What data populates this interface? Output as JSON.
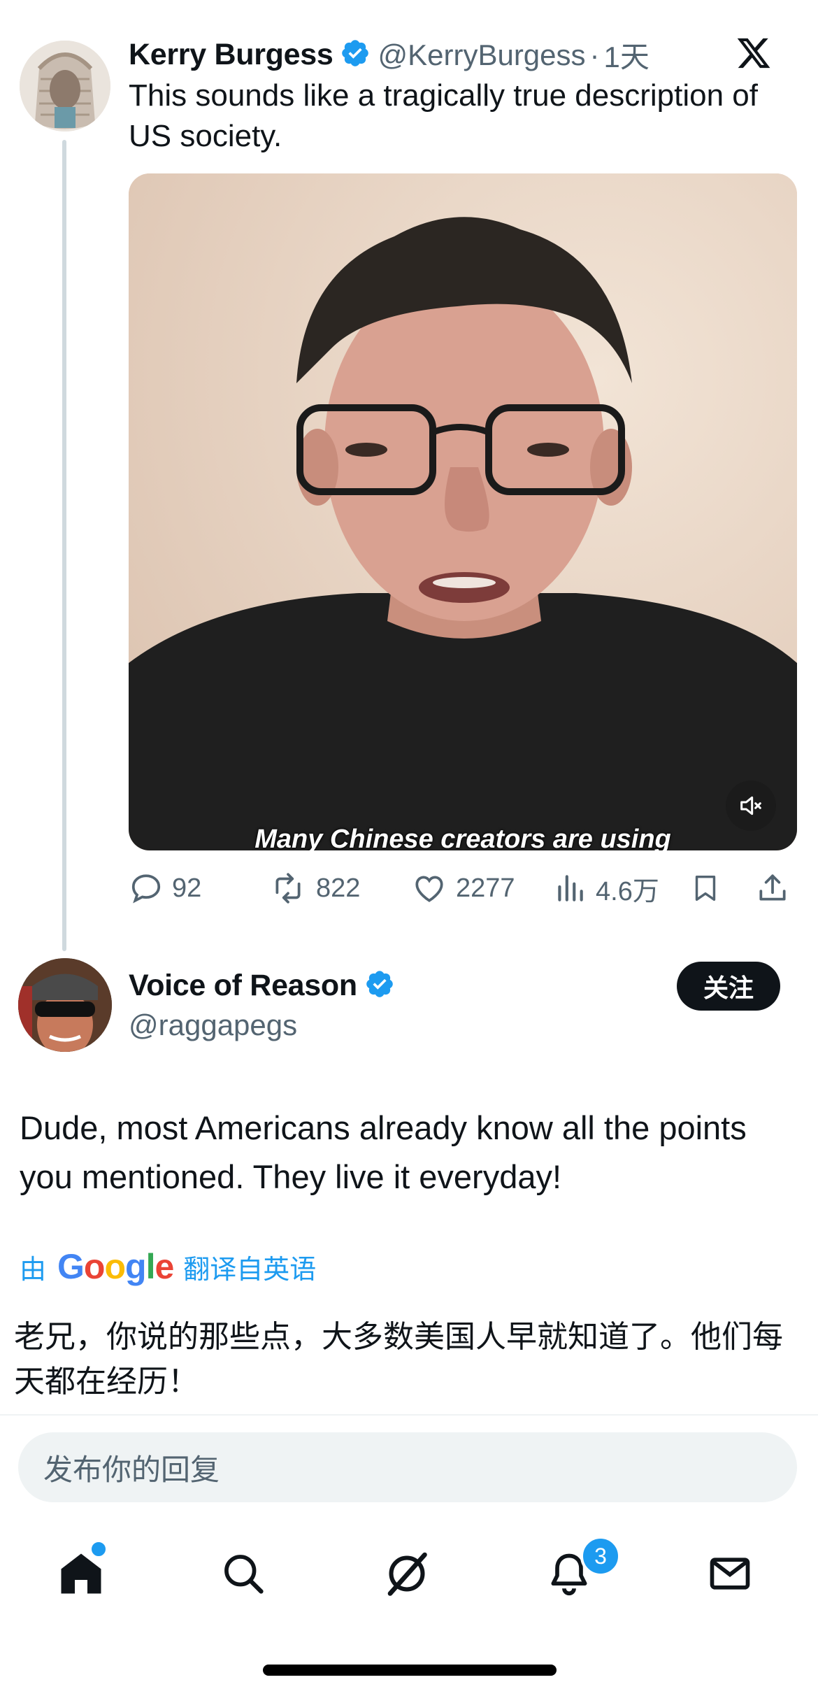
{
  "original_tweet": {
    "name": "Kerry Burgess",
    "handle": "@KerryBurgess",
    "separator": "·",
    "time": "1天",
    "text": "This sounds like a tragically true description of US society.",
    "video_caption": "Many Chinese creators are using",
    "stats": {
      "replies": "92",
      "retweets": "822",
      "likes": "2277",
      "views": "4.6万"
    }
  },
  "reply_tweet": {
    "name": "Voice of Reason",
    "handle": "@raggapegs",
    "follow_label": "关注",
    "text": "Dude, most Americans already know all the points you mentioned. They live it everyday!",
    "translate_prefix": "由",
    "translate_brand": "Google",
    "translate_suffix": "翻译自英语",
    "translated_text": "老兄，你说的那些点，大多数美国人早就知道了。他们每天都在经历！"
  },
  "reply_box": {
    "placeholder": "发布你的回复"
  },
  "bottom_nav": {
    "items": [
      "home-icon",
      "search-icon",
      "grok-icon",
      "bell-icon",
      "mail-icon"
    ],
    "notification_count": "3"
  },
  "colors": {
    "accent": "#1d9bf0",
    "text": "#0f1419",
    "secondary": "#536471"
  }
}
